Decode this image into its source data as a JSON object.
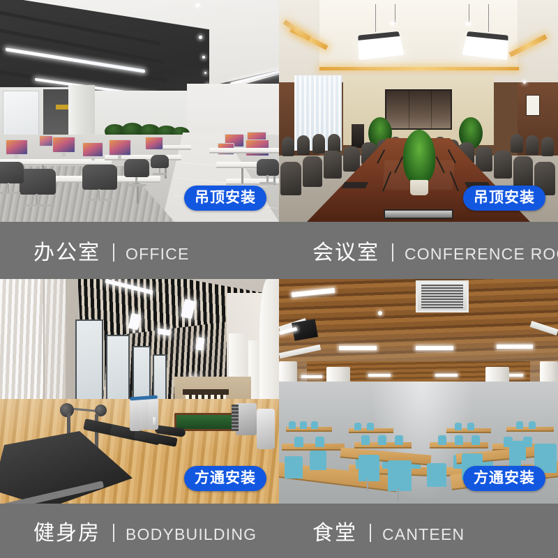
{
  "layout": {
    "rows": 2,
    "cols": 2,
    "bar_color": "#727272",
    "badge_color": "#1257e0",
    "text_color": "#ffffff"
  },
  "cells": [
    {
      "id": "office",
      "scene": "open-plan-office-interior",
      "badge": "吊顶安装",
      "title_cn": "办公室",
      "separator": "|",
      "title_en": "OFFICE"
    },
    {
      "id": "conference-room",
      "scene": "conference-room-interior",
      "badge": "吊顶安装",
      "title_cn": "会议室",
      "separator": "|",
      "title_en": "CONFERENCE ROOM"
    },
    {
      "id": "bodybuilding",
      "scene": "gym-interior",
      "badge": "方通安装",
      "title_cn": "健身房",
      "separator": "|",
      "title_en": "BODYBUILDING"
    },
    {
      "id": "canteen",
      "scene": "canteen-interior",
      "badge": "方通安装",
      "title_cn": "食堂",
      "separator": "|",
      "title_en": "CANTEEN"
    }
  ]
}
